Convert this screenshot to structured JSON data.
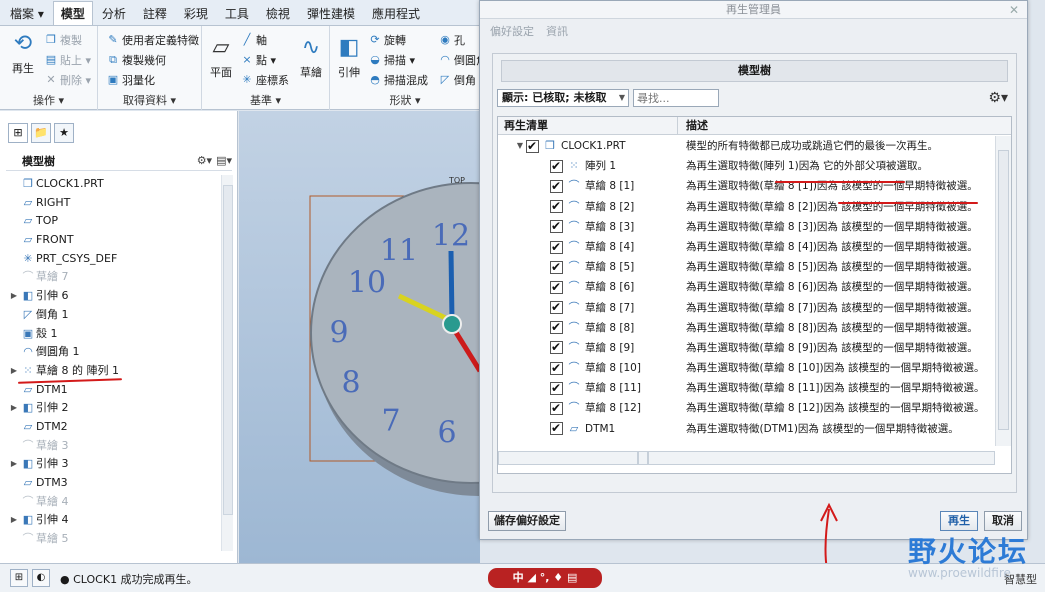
{
  "tabs": [
    "檔案 ▾",
    "模型",
    "分析",
    "註釋",
    "彩現",
    "工具",
    "檢視",
    "彈性建模",
    "應用程式"
  ],
  "ribbon": {
    "groups": {
      "operations": "操作 ▾",
      "get_data": "取得資料 ▾",
      "datum": "基準 ▾",
      "shapes": "形狀 ▾"
    },
    "buttons": {
      "regenerate": "再生",
      "copy": "複製",
      "paste": "貼上 ▾",
      "delete": "刪除 ▾",
      "user_defined_feature": "使用者定義特徵",
      "copy_geometry": "複製幾何",
      "shrinkwrap": "羽量化",
      "plane": "平面",
      "axis": "軸",
      "point": "點 ▾",
      "csys": "座標系",
      "sketch": "草繪",
      "extrude": "引伸",
      "revolve": "旋轉",
      "sweep": "掃描 ▾",
      "swept_blend": "掃描混成",
      "hole": "孔",
      "round": "倒圓角",
      "chamfer": "倒角"
    }
  },
  "left_panel": {
    "title": "模型樹",
    "tree": [
      {
        "label": "CLOCK1.PRT",
        "icon": "part-icon",
        "exp": "",
        "dim": false
      },
      {
        "label": "RIGHT",
        "icon": "datum-plane-icon",
        "exp": "",
        "dim": false
      },
      {
        "label": "TOP",
        "icon": "datum-plane-icon",
        "exp": "",
        "dim": false
      },
      {
        "label": "FRONT",
        "icon": "datum-plane-icon",
        "exp": "",
        "dim": false
      },
      {
        "label": "PRT_CSYS_DEF",
        "icon": "csys-icon",
        "exp": "",
        "dim": false
      },
      {
        "label": "草繪 7",
        "icon": "sketch-icon",
        "exp": "",
        "dim": true
      },
      {
        "label": "引伸 6",
        "icon": "extrude-icon",
        "exp": "▶",
        "dim": false
      },
      {
        "label": "倒角 1",
        "icon": "chamfer-icon",
        "exp": "",
        "dim": false
      },
      {
        "label": "殼 1",
        "icon": "shell-icon",
        "exp": "",
        "dim": false
      },
      {
        "label": "倒圓角 1",
        "icon": "round-icon",
        "exp": "",
        "dim": false
      },
      {
        "label": "草繪 8 的 陣列 1",
        "icon": "pattern-icon",
        "exp": "▶",
        "dim": false
      },
      {
        "label": "DTM1",
        "icon": "datum-plane-icon",
        "exp": "",
        "dim": false
      },
      {
        "label": "引伸 2",
        "icon": "extrude-icon",
        "exp": "▶",
        "dim": false
      },
      {
        "label": "DTM2",
        "icon": "datum-plane-icon",
        "exp": "",
        "dim": false
      },
      {
        "label": "草繪 3",
        "icon": "sketch-icon",
        "exp": "",
        "dim": true
      },
      {
        "label": "引伸 3",
        "icon": "extrude-icon",
        "exp": "▶",
        "dim": false
      },
      {
        "label": "DTM3",
        "icon": "datum-plane-icon",
        "exp": "",
        "dim": false
      },
      {
        "label": "草繪 4",
        "icon": "sketch-icon",
        "exp": "",
        "dim": true
      },
      {
        "label": "引伸 4",
        "icon": "extrude-icon",
        "exp": "▶",
        "dim": false
      },
      {
        "label": "草繪 5",
        "icon": "sketch-icon",
        "exp": "",
        "dim": true
      }
    ]
  },
  "viewport": {
    "top_label": "TOP",
    "clock_numerals": [
      "12",
      "11",
      "10",
      "9",
      "8",
      "7",
      "6"
    ]
  },
  "dialog": {
    "title": "再生管理員",
    "menu": [
      "偏好設定",
      "資訊"
    ],
    "model_tree_title": "模型樹",
    "filter_value": "顯示: 已核取; 未核取",
    "search_placeholder": "尋找...",
    "columns": [
      "再生清單",
      "描述"
    ],
    "rows": [
      {
        "name": "CLOCK1.PRT",
        "icon": "part-icon",
        "exp": "▼",
        "indent": 0,
        "desc": "模型的所有特徵都已成功或跳過它們的最後一次再生。"
      },
      {
        "name": "陣列 1",
        "icon": "pattern-icon",
        "exp": "",
        "indent": 1,
        "desc": "為再生選取特徵(陣列 1)因為 它的外部父項被選取。"
      },
      {
        "name": "草繪 8 [1]",
        "icon": "sketch-icon",
        "exp": "",
        "indent": 1,
        "desc": "為再生選取特徵(草繪 8 [1])因為 該模型的一個早期特徵被選。"
      },
      {
        "name": "草繪 8 [2]",
        "icon": "sketch-icon",
        "exp": "",
        "indent": 1,
        "desc": "為再生選取特徵(草繪 8 [2])因為 該模型的一個早期特徵被選。"
      },
      {
        "name": "草繪 8 [3]",
        "icon": "sketch-icon",
        "exp": "",
        "indent": 1,
        "desc": "為再生選取特徵(草繪 8 [3])因為 該模型的一個早期特徵被選。"
      },
      {
        "name": "草繪 8 [4]",
        "icon": "sketch-icon",
        "exp": "",
        "indent": 1,
        "desc": "為再生選取特徵(草繪 8 [4])因為 該模型的一個早期特徵被選。"
      },
      {
        "name": "草繪 8 [5]",
        "icon": "sketch-icon",
        "exp": "",
        "indent": 1,
        "desc": "為再生選取特徵(草繪 8 [5])因為 該模型的一個早期特徵被選。"
      },
      {
        "name": "草繪 8 [6]",
        "icon": "sketch-icon",
        "exp": "",
        "indent": 1,
        "desc": "為再生選取特徵(草繪 8 [6])因為 該模型的一個早期特徵被選。"
      },
      {
        "name": "草繪 8 [7]",
        "icon": "sketch-icon",
        "exp": "",
        "indent": 1,
        "desc": "為再生選取特徵(草繪 8 [7])因為 該模型的一個早期特徵被選。"
      },
      {
        "name": "草繪 8 [8]",
        "icon": "sketch-icon",
        "exp": "",
        "indent": 1,
        "desc": "為再生選取特徵(草繪 8 [8])因為 該模型的一個早期特徵被選。"
      },
      {
        "name": "草繪 8 [9]",
        "icon": "sketch-icon",
        "exp": "",
        "indent": 1,
        "desc": "為再生選取特徵(草繪 8 [9])因為 該模型的一個早期特徵被選。"
      },
      {
        "name": "草繪 8 [10]",
        "icon": "sketch-icon",
        "exp": "",
        "indent": 1,
        "desc": "為再生選取特徵(草繪 8 [10])因為 該模型的一個早期特徵被選。"
      },
      {
        "name": "草繪 8 [11]",
        "icon": "sketch-icon",
        "exp": "",
        "indent": 1,
        "desc": "為再生選取特徵(草繪 8 [11])因為 該模型的一個早期特徵被選。"
      },
      {
        "name": "草繪 8 [12]",
        "icon": "sketch-icon",
        "exp": "",
        "indent": 1,
        "desc": "為再生選取特徵(草繪 8 [12])因為 該模型的一個早期特徵被選。"
      },
      {
        "name": "DTM1",
        "icon": "datum-plane-icon",
        "exp": "",
        "indent": 1,
        "desc": "為再生選取特徵(DTM1)因為 該模型的一個早期特徵被選。"
      }
    ],
    "save_prefs": "儲存偏好設定",
    "regenerate": "再生",
    "cancel": "取消"
  },
  "statusbar": {
    "message": "● CLOCK1 成功完成再生。",
    "ime": "中 ◢ °, ♦ ▤",
    "right": "智慧型"
  },
  "watermark": {
    "text": "野火论坛",
    "url": "www.proewildfire"
  },
  "colors": {
    "accent": "#2e7bbf",
    "annotation_red": "#d31a1a",
    "clock_numerals": "#3a5fb8"
  }
}
